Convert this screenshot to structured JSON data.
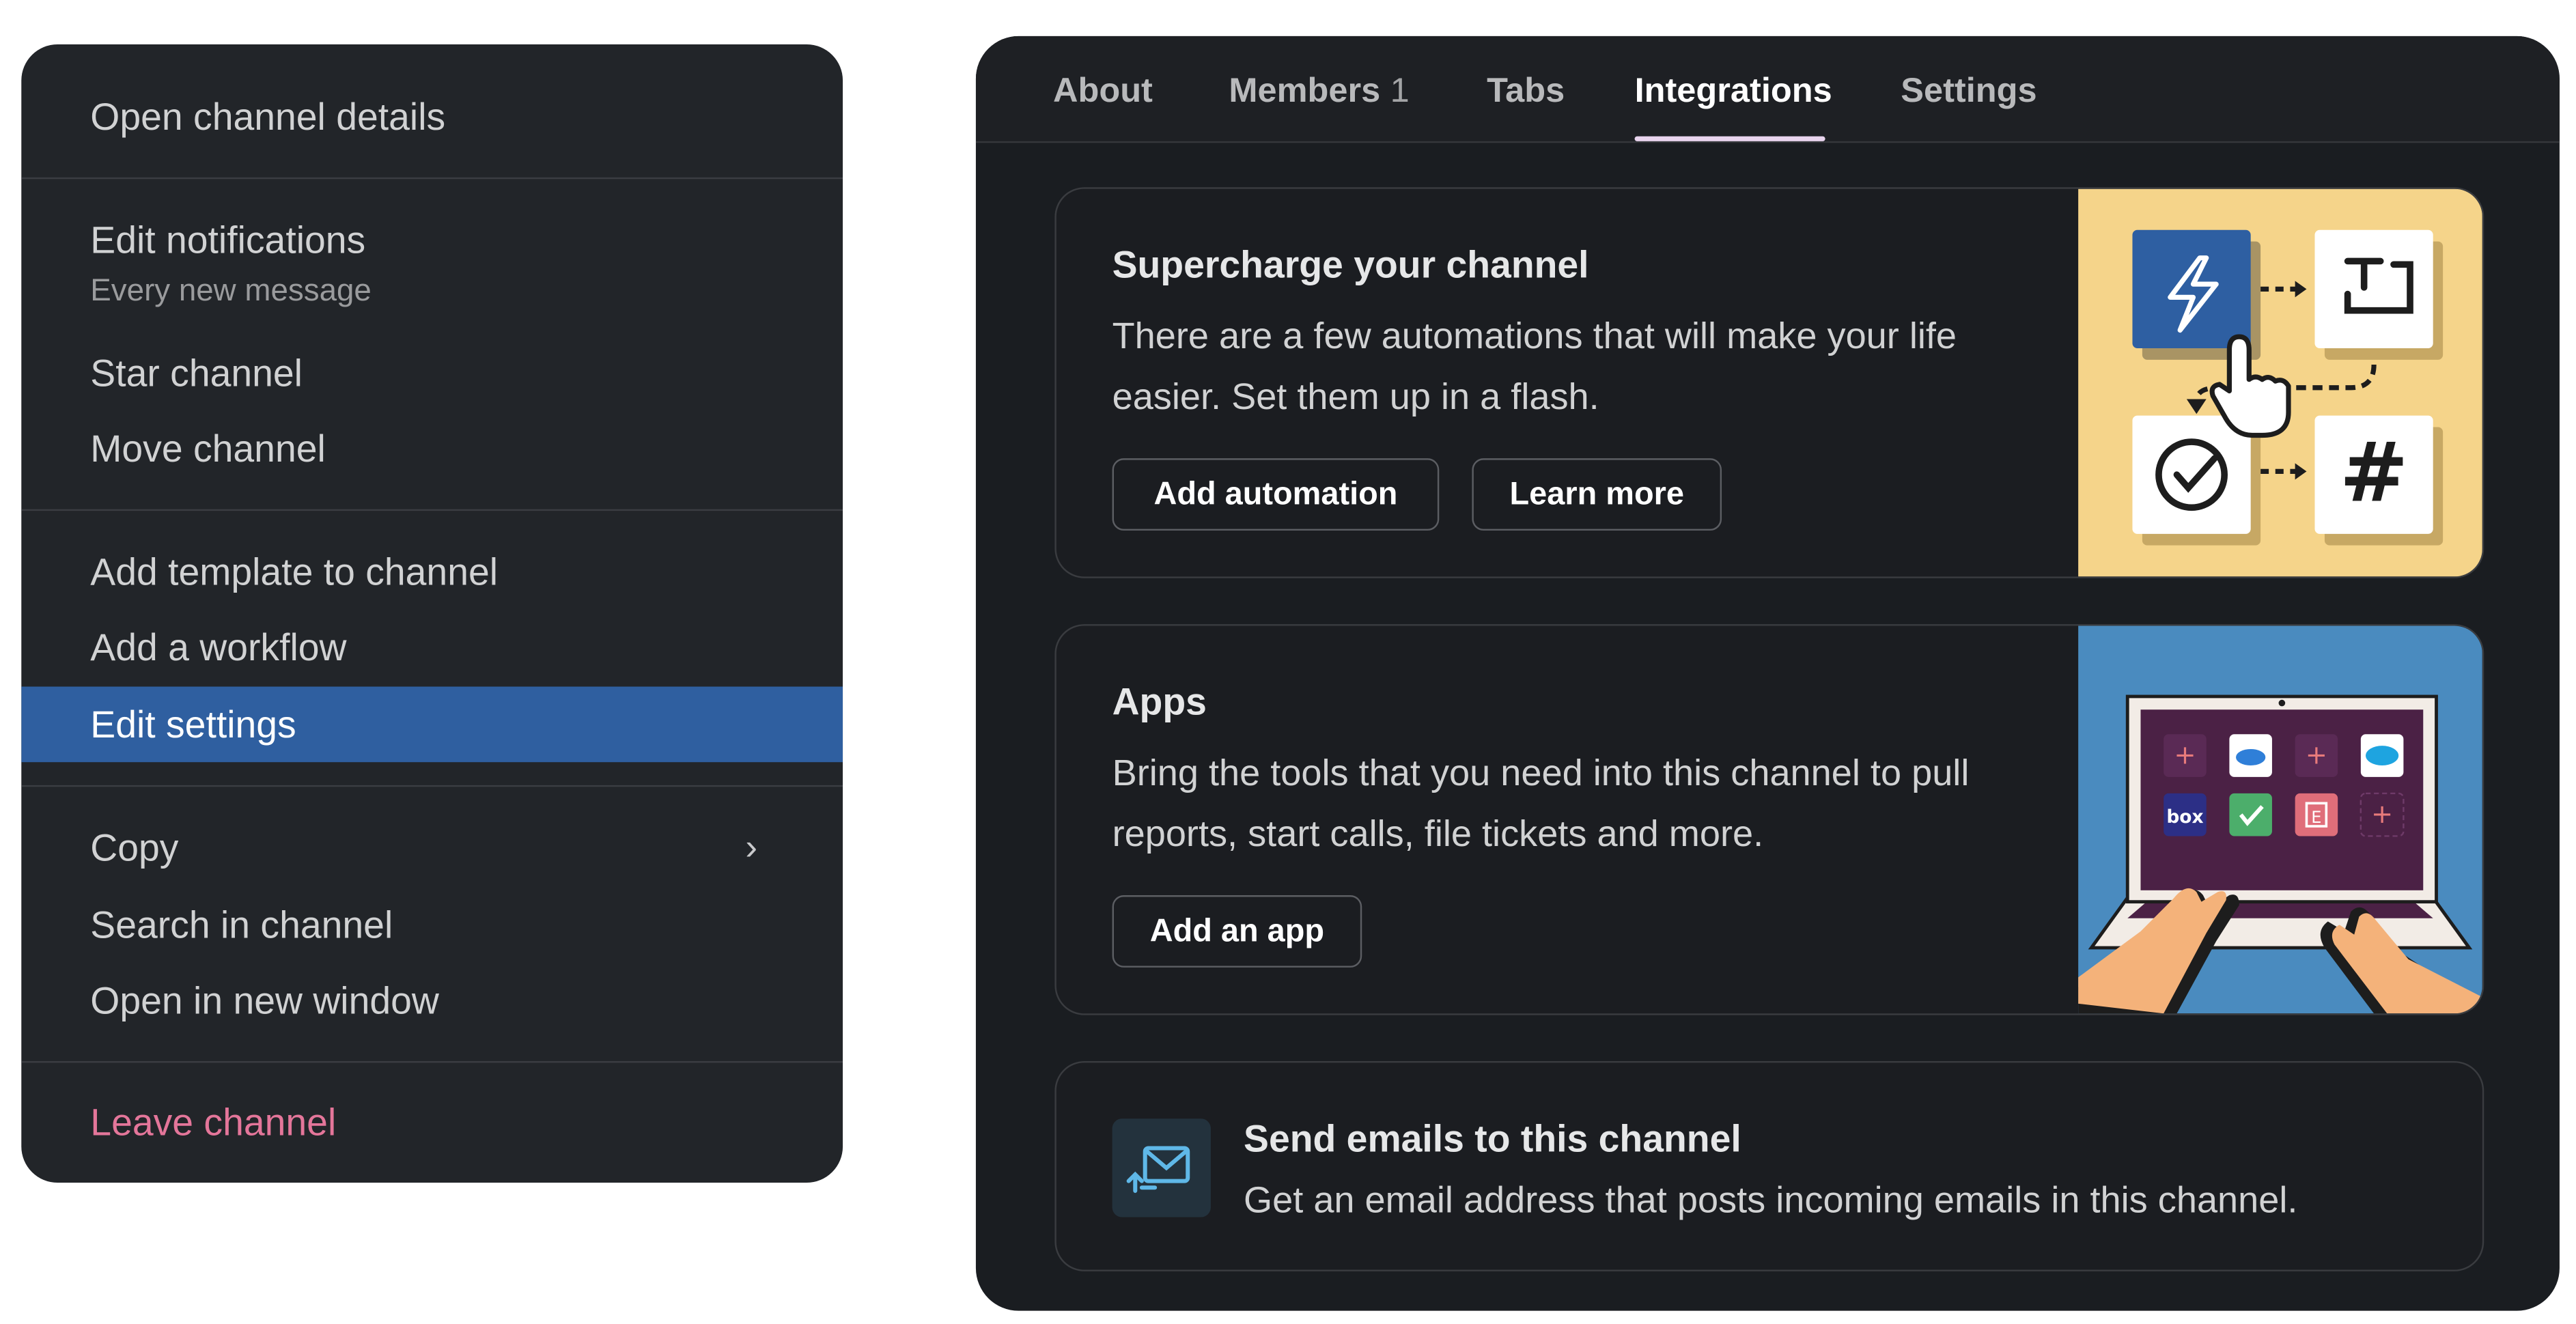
{
  "menu": {
    "open_details": "Open channel details",
    "edit_notifications": "Edit notifications",
    "edit_notifications_sub": "Every new message",
    "star_channel": "Star channel",
    "move_channel": "Move channel",
    "add_template": "Add template to channel",
    "add_workflow": "Add a workflow",
    "edit_settings": "Edit settings",
    "copy": "Copy",
    "search_in_channel": "Search in channel",
    "open_new_window": "Open in new window",
    "leave_channel": "Leave channel"
  },
  "tabs": {
    "about": "About",
    "members": "Members",
    "members_count": "1",
    "tabs": "Tabs",
    "integrations": "Integrations",
    "settings": "Settings",
    "active": "Integrations"
  },
  "automation_card": {
    "title": "Supercharge your channel",
    "desc": "There are a few automations that will make your life easier. Set them up in a flash.",
    "add_button": "Add automation",
    "learn_button": "Learn more",
    "illustration_glyphs": [
      "lightning-icon",
      "text-icon",
      "check-icon",
      "#"
    ]
  },
  "apps_card": {
    "title": "Apps",
    "desc": "Bring the tools that you need into this channel to pull reports, start calls, file tickets and more.",
    "add_button": "Add an app",
    "laptop_tiles": [
      "+",
      "cloud",
      "+",
      "salesforce",
      "box",
      "check",
      "E",
      "+"
    ]
  },
  "email_card": {
    "title": "Send emails to this channel",
    "desc": "Get an email address that posts incoming emails in this channel."
  },
  "colors": {
    "menu_bg": "#222529",
    "menu_active": "#2f5fa0",
    "danger": "#e4769a",
    "panel_bg": "#1a1d21",
    "automation_illus_bg": "#f5d48a",
    "apps_illus_bg": "#4a8bbf"
  }
}
